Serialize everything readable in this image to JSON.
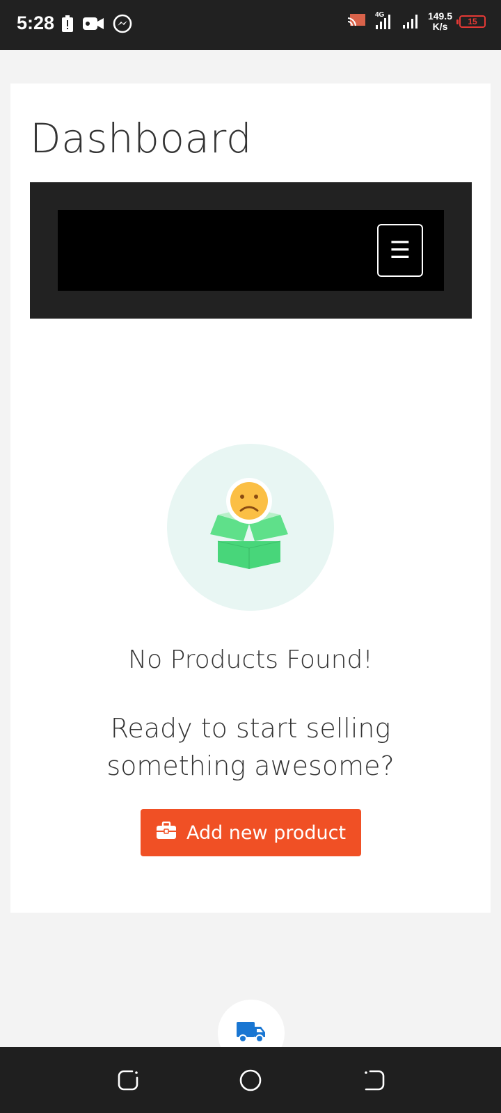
{
  "status_bar": {
    "time": "5:28",
    "speed_value": "149.5",
    "speed_unit": "K/s",
    "battery": "15",
    "network": "4G"
  },
  "page": {
    "title": "Dashboard"
  },
  "menu_toggle": {
    "glyph": "☰"
  },
  "empty_state": {
    "title": "No Products Found!",
    "subtitle_line1": "Ready to start selling",
    "subtitle_line2": "something awesome?",
    "button_label": "Add new product"
  },
  "icons": {
    "status_left": [
      "battery-alert-icon",
      "video-camera-icon",
      "messenger-icon"
    ],
    "status_right": [
      "cast-icon",
      "signal-4g-icon",
      "signal-icon",
      "battery-icon"
    ],
    "empty": "sad-box-icon",
    "button": "briefcase-icon",
    "fab": "truck-icon",
    "nav": [
      "recent-apps-icon",
      "home-icon",
      "back-icon"
    ]
  },
  "colors": {
    "accent": "#f05025",
    "navbar": "#222222",
    "illustration_bg": "#e8f6f3",
    "box_green": "#4cd97b",
    "sad_face": "#fbbf45",
    "truck": "#1976d2"
  }
}
